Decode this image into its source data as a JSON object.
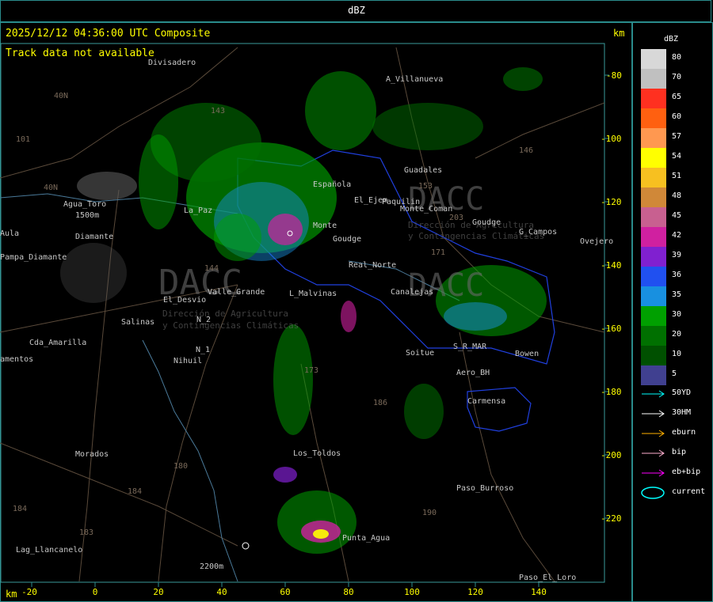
{
  "header": {
    "title": "dBZ"
  },
  "map": {
    "timestamp": "2025/12/12 04:36:00 UTC Composite",
    "status": "Track data not available",
    "units": "km",
    "x_ticks": [
      "-20",
      "0",
      "20",
      "40",
      "60",
      "80",
      "100",
      "120",
      "140"
    ],
    "y_ticks": [
      "-80",
      "-100",
      "-120",
      "-140",
      "-160",
      "-180",
      "-200",
      "-220"
    ],
    "places": [
      "Divisadero",
      "A_Villanueva",
      "Guadales",
      "Agua_Toro",
      "1500m",
      "La_Paz",
      "Pampa_Diamante",
      "Española",
      "El_Ejem",
      "Paquilin",
      "Monte_Coman",
      "Goudge",
      "El_Desvio",
      "Valle_Grande",
      "L_Malvinas",
      "Real_Norte",
      "Salinas",
      "Cda_Amarilla",
      "Nihuil",
      "N_1",
      "N_2",
      "Soitue",
      "Bowen",
      "Carmensa",
      "Los_Toldos",
      "Morados",
      "Paso_Burroso",
      "Punta_Agua",
      "Lag_Llancanelo",
      "2200m",
      "Paso_El_Loro",
      "Ovejero",
      "G_Campos",
      "Goudge",
      "Monte",
      "Aero_BH",
      "S_R_MAR",
      "Canalejas",
      "Diamante",
      "Pampa",
      "Aula",
      "amentos"
    ],
    "route_numbers": [
      "101",
      "40N",
      "40N",
      "143",
      "144",
      "146",
      "153",
      "171",
      "173",
      "180",
      "184",
      "186",
      "183",
      "190",
      "184",
      "203"
    ],
    "watermark": [
      "DACC",
      "Dirección de Agricultura",
      "y Contingencias Climáticas"
    ]
  },
  "legend": {
    "dbz_levels": [
      {
        "value": "80",
        "color": "#d8d8d8"
      },
      {
        "value": "70",
        "color": "#c0c0c0"
      },
      {
        "value": "65",
        "color": "#ff3020"
      },
      {
        "value": "60",
        "color": "#ff6010"
      },
      {
        "value": "57",
        "color": "#ff9850"
      },
      {
        "value": "54",
        "color": "#ffff00"
      },
      {
        "value": "51",
        "color": "#f7c020"
      },
      {
        "value": "48",
        "color": "#d08838"
      },
      {
        "value": "45",
        "color": "#c86090"
      },
      {
        "value": "42",
        "color": "#d020a0"
      },
      {
        "value": "39",
        "color": "#8020d0"
      },
      {
        "value": "36",
        "color": "#2050f0"
      },
      {
        "value": "35",
        "color": "#1890e0"
      },
      {
        "value": "30",
        "color": "#00a000"
      },
      {
        "value": "20",
        "color": "#007000"
      },
      {
        "value": "10",
        "color": "#005000"
      },
      {
        "value": "5",
        "color": "#404090"
      }
    ],
    "tracks": [
      {
        "label": "50YD",
        "color": "#00ffff",
        "icon": "arrow-icon"
      },
      {
        "label": "30HM",
        "color": "#ffffff",
        "icon": "arrow-icon"
      },
      {
        "label": "eburn",
        "color": "#ffb000",
        "icon": "arrow-icon"
      },
      {
        "label": "bip",
        "color": "#ffb0d0",
        "icon": "arrow-icon"
      },
      {
        "label": "eb+bip",
        "color": "#ff00ff",
        "icon": "arrow-icon"
      },
      {
        "label": "current",
        "color": "#00ffff",
        "icon": "ellipse-icon"
      }
    ]
  }
}
